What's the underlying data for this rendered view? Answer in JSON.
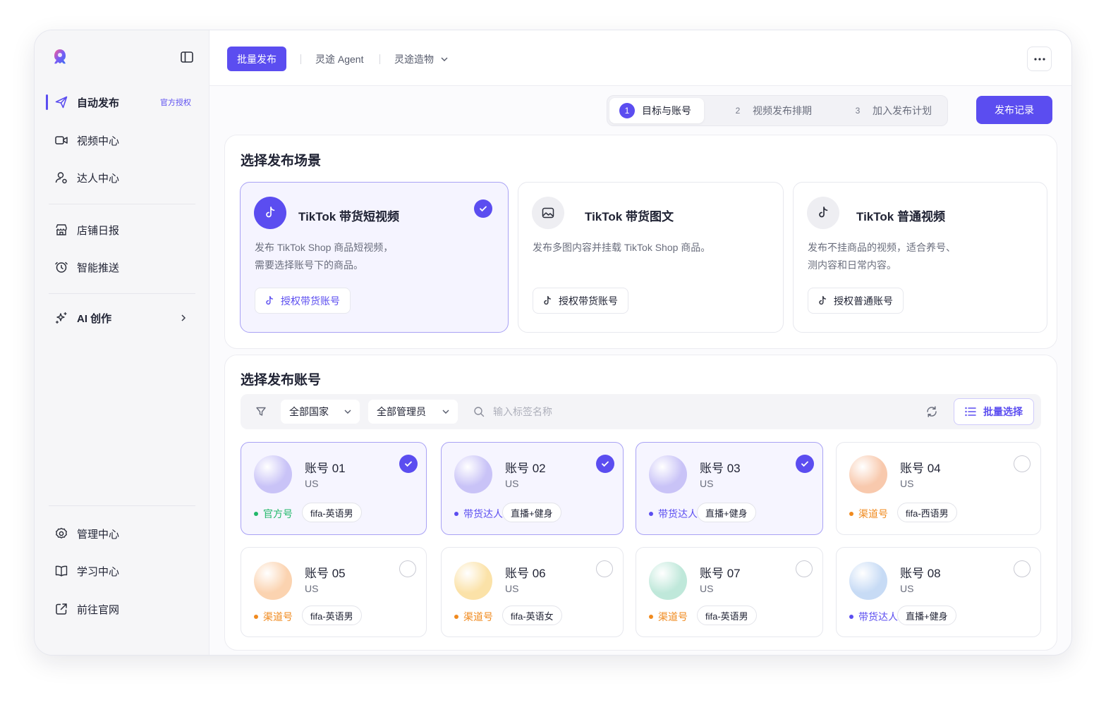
{
  "colors": {
    "accent": "#5b4df0",
    "official": "#22b86a",
    "channel": "#f08a1e",
    "creator": "#5b4df0"
  },
  "sidebar": {
    "items": [
      {
        "label": "自动发布",
        "icon": "send-icon",
        "badge": "官方授权",
        "active": true
      },
      {
        "label": "视频中心",
        "icon": "video-icon"
      },
      {
        "label": "达人中心",
        "icon": "user-icon"
      },
      {
        "label": "店铺日报",
        "icon": "store-icon"
      },
      {
        "label": "智能推送",
        "icon": "target-icon"
      },
      {
        "label": "AI 创作",
        "icon": "sparkle-icon"
      }
    ],
    "bottom": [
      {
        "label": "管理中心",
        "icon": "gear-icon"
      },
      {
        "label": "学习中心",
        "icon": "book-icon"
      },
      {
        "label": "前往官网",
        "icon": "external-link-icon"
      }
    ]
  },
  "topbar": {
    "primary": "批量发布",
    "links": [
      "灵途 Agent",
      "灵途造物"
    ]
  },
  "steps": [
    {
      "num": "1",
      "label": "目标与账号",
      "active": true
    },
    {
      "num": "2",
      "label": "视频发布排期"
    },
    {
      "num": "3",
      "label": "加入发布计划"
    }
  ],
  "record_button": "发布记录",
  "scene_section": {
    "title": "选择发布场景",
    "cards": [
      {
        "title": "TikTok 带货短视频",
        "desc": [
          "发布 TikTok Shop 商品短视频，",
          "需要选择账号下的商品。"
        ],
        "button": "授权带货账号",
        "selected": true
      },
      {
        "title": "TikTok 带货图文",
        "desc": [
          "发布多图内容并挂载 TikTok Shop 商品。"
        ],
        "button": "授权带货账号",
        "selected": false
      },
      {
        "title": "TikTok 普通视频",
        "desc": [
          "发布不挂商品的视频，适合养号、",
          "测内容和日常内容。"
        ],
        "button": "授权普通账号",
        "selected": false
      }
    ]
  },
  "account_section": {
    "title": "选择发布账号",
    "filters": {
      "country": "全部国家",
      "manager": "全部管理员",
      "search_placeholder": "输入标签名称",
      "batch": "批量选择"
    },
    "accounts": [
      {
        "name": "账号 01",
        "country": "US",
        "type": "官方号",
        "tag": "fifa-英语男",
        "selected": true,
        "avatar": "#c9c3f7"
      },
      {
        "name": "账号 02",
        "country": "US",
        "type": "带货达人号",
        "tag": "直播+健身",
        "selected": true,
        "avatar": "#c9c3f7"
      },
      {
        "name": "账号 03",
        "country": "US",
        "type": "带货达人号",
        "tag": "直播+健身",
        "selected": true,
        "avatar": "#c9c3f7"
      },
      {
        "name": "账号 04",
        "country": "US",
        "type": "渠道号",
        "tag": "fifa-西语男",
        "selected": false,
        "avatar": "#f8c9ad"
      },
      {
        "name": "账号 05",
        "country": "US",
        "type": "渠道号",
        "tag": "fifa-英语男",
        "selected": false,
        "avatar": "#fbd3b0"
      },
      {
        "name": "账号 06",
        "country": "US",
        "type": "渠道号",
        "tag": "fifa-英语女",
        "selected": false,
        "avatar": "#fbe2a8"
      },
      {
        "name": "账号 07",
        "country": "US",
        "type": "渠道号",
        "tag": "fifa-英语男",
        "selected": false,
        "avatar": "#bfe8da"
      },
      {
        "name": "账号 08",
        "country": "US",
        "type": "带货达人号",
        "tag": "直播+健身",
        "selected": false,
        "avatar": "#c7dbf5"
      }
    ]
  }
}
